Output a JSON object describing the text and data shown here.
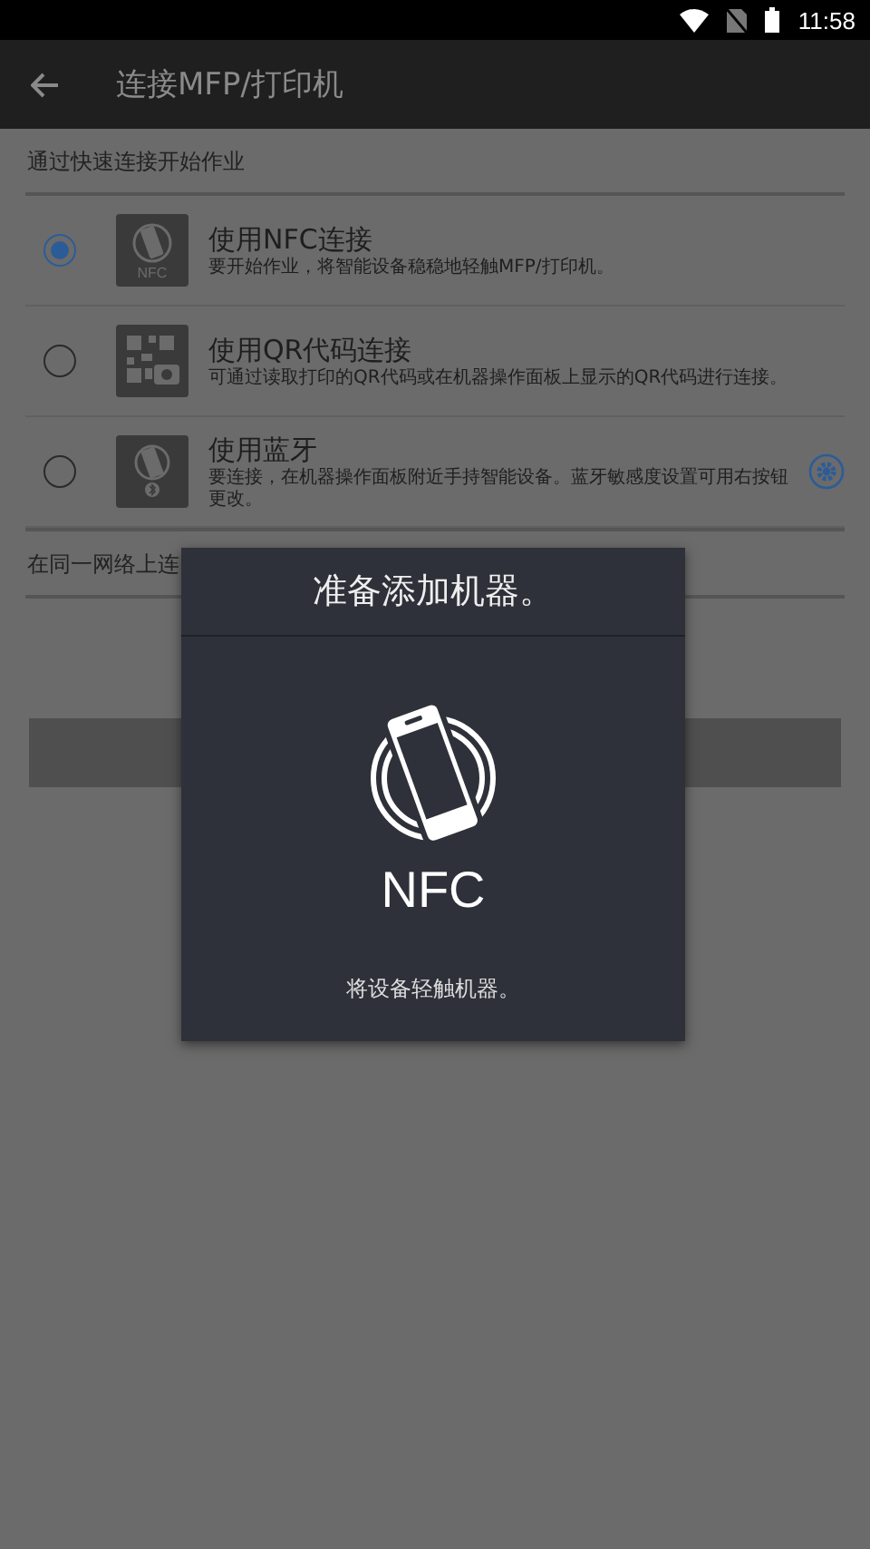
{
  "status_bar": {
    "time": "11:58"
  },
  "app_bar": {
    "title": "连接MFP/打印机"
  },
  "quick_section": {
    "heading": "通过快速连接开始作业"
  },
  "options": [
    {
      "kind": "nfc",
      "title": "使用NFC连接",
      "description": "要开始作业，将智能设备稳稳地轻触MFP/打印机。",
      "icon_label": "NFC",
      "selected": true,
      "has_settings": false
    },
    {
      "kind": "qr",
      "title": "使用QR代码连接",
      "description": "可通过读取打印的QR代码或在机器操作面板上显示的QR代码进行连接。",
      "selected": false,
      "has_settings": false
    },
    {
      "kind": "bluetooth",
      "title": "使用蓝牙",
      "description": "要连接，在机器操作面板附近手持智能设备。蓝牙敏感度设置可用右按钮更改。",
      "selected": false,
      "has_settings": true
    }
  ],
  "network_section": {
    "heading": "在同一网络上连"
  },
  "dialog": {
    "title": "准备添加机器。",
    "label": "NFC",
    "message": "将设备轻触机器。"
  }
}
